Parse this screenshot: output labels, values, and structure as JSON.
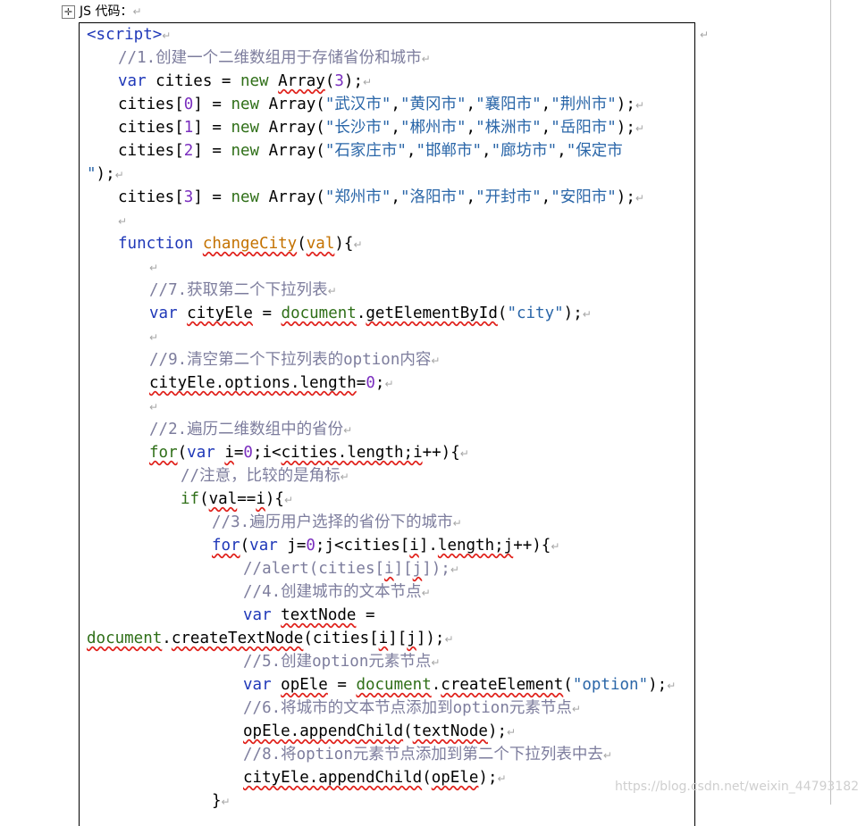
{
  "caption": {
    "label": "JS 代码：",
    "mark": "↵"
  },
  "line_mark": "↵",
  "watermark": "https://blog.csdn.net/weixin_44793182",
  "code_lines": [
    {
      "indent": 0,
      "tokens": [
        {
          "t": "<script>",
          "c": "tag"
        }
      ]
    },
    {
      "indent": 1,
      "tokens": [
        {
          "t": "//1.创建一个二维数组用于存储省份和城市",
          "c": "cm"
        }
      ]
    },
    {
      "indent": 1,
      "tokens": [
        {
          "t": "var",
          "c": "kw"
        },
        {
          "t": " cities = ",
          "c": "plain"
        },
        {
          "t": "new",
          "c": "obj"
        },
        {
          "t": " ",
          "c": "plain"
        },
        {
          "t": "Array",
          "c": "plain",
          "sq": true
        },
        {
          "t": "(",
          "c": "plain"
        },
        {
          "t": "3",
          "c": "num"
        },
        {
          "t": ");",
          "c": "plain"
        }
      ]
    },
    {
      "indent": 1,
      "tokens": [
        {
          "t": "cities[",
          "c": "plain"
        },
        {
          "t": "0",
          "c": "num"
        },
        {
          "t": "] = ",
          "c": "plain"
        },
        {
          "t": "new",
          "c": "obj"
        },
        {
          "t": " Array(",
          "c": "plain"
        },
        {
          "t": "\"武汉市\"",
          "c": "str"
        },
        {
          "t": ",",
          "c": "plain"
        },
        {
          "t": "\"黄冈市\"",
          "c": "str"
        },
        {
          "t": ",",
          "c": "plain"
        },
        {
          "t": "\"襄阳市\"",
          "c": "str"
        },
        {
          "t": ",",
          "c": "plain"
        },
        {
          "t": "\"荆州市\"",
          "c": "str"
        },
        {
          "t": ");",
          "c": "plain"
        }
      ]
    },
    {
      "indent": 1,
      "tokens": [
        {
          "t": "cities[",
          "c": "plain"
        },
        {
          "t": "1",
          "c": "num"
        },
        {
          "t": "] = ",
          "c": "plain"
        },
        {
          "t": "new",
          "c": "obj"
        },
        {
          "t": " Array(",
          "c": "plain"
        },
        {
          "t": "\"长沙市\"",
          "c": "str"
        },
        {
          "t": ",",
          "c": "plain"
        },
        {
          "t": "\"郴州市\"",
          "c": "str"
        },
        {
          "t": ",",
          "c": "plain"
        },
        {
          "t": "\"株洲市\"",
          "c": "str"
        },
        {
          "t": ",",
          "c": "plain"
        },
        {
          "t": "\"岳阳市\"",
          "c": "str"
        },
        {
          "t": ");",
          "c": "plain"
        }
      ]
    },
    {
      "indent": 1,
      "tokens": [
        {
          "t": "cities[",
          "c": "plain"
        },
        {
          "t": "2",
          "c": "num"
        },
        {
          "t": "] = ",
          "c": "plain"
        },
        {
          "t": "new",
          "c": "obj"
        },
        {
          "t": " Array(",
          "c": "plain"
        },
        {
          "t": "\"石家庄市\"",
          "c": "str"
        },
        {
          "t": ",",
          "c": "plain"
        },
        {
          "t": "\"邯郸市\"",
          "c": "str"
        },
        {
          "t": ",",
          "c": "plain"
        },
        {
          "t": "\"廊坊市\"",
          "c": "str"
        },
        {
          "t": ",",
          "c": "plain"
        },
        {
          "t": "\"保定市",
          "c": "str"
        }
      ],
      "nomark": true
    },
    {
      "indent": 0,
      "tokens": [
        {
          "t": "\"",
          "c": "str"
        },
        {
          "t": ");",
          "c": "plain"
        }
      ]
    },
    {
      "indent": 1,
      "tokens": [
        {
          "t": "cities[",
          "c": "plain"
        },
        {
          "t": "3",
          "c": "num"
        },
        {
          "t": "] = ",
          "c": "plain"
        },
        {
          "t": "new",
          "c": "obj"
        },
        {
          "t": " Array(",
          "c": "plain"
        },
        {
          "t": "\"郑州市\"",
          "c": "str"
        },
        {
          "t": ",",
          "c": "plain"
        },
        {
          "t": "\"洛阳市\"",
          "c": "str"
        },
        {
          "t": ",",
          "c": "plain"
        },
        {
          "t": "\"开封市\"",
          "c": "str"
        },
        {
          "t": ",",
          "c": "plain"
        },
        {
          "t": "\"安阳市\"",
          "c": "str"
        },
        {
          "t": ");",
          "c": "plain"
        }
      ]
    },
    {
      "indent": 1,
      "tokens": []
    },
    {
      "indent": 1,
      "tokens": [
        {
          "t": "function",
          "c": "kw"
        },
        {
          "t": " ",
          "c": "plain"
        },
        {
          "t": "changeCity",
          "c": "fn",
          "sq": true
        },
        {
          "t": "(",
          "c": "plain"
        },
        {
          "t": "val",
          "c": "fn",
          "sq": true
        },
        {
          "t": "){",
          "c": "plain"
        }
      ]
    },
    {
      "indent": 2,
      "tokens": []
    },
    {
      "indent": 2,
      "tokens": [
        {
          "t": "//7.获取第二个下拉列表",
          "c": "cm"
        }
      ]
    },
    {
      "indent": 2,
      "tokens": [
        {
          "t": "var",
          "c": "kw"
        },
        {
          "t": " ",
          "c": "plain"
        },
        {
          "t": "cityEle",
          "c": "plain",
          "sq": true
        },
        {
          "t": " = ",
          "c": "plain"
        },
        {
          "t": "document",
          "c": "obj",
          "sq": true
        },
        {
          "t": ".",
          "c": "plain"
        },
        {
          "t": "getElementById",
          "c": "plain",
          "sq": true
        },
        {
          "t": "(",
          "c": "plain"
        },
        {
          "t": "\"city\"",
          "c": "str"
        },
        {
          "t": ");",
          "c": "plain"
        }
      ]
    },
    {
      "indent": 2,
      "tokens": []
    },
    {
      "indent": 2,
      "tokens": [
        {
          "t": "//9.清空第二个下拉列表的option内容",
          "c": "cm"
        }
      ]
    },
    {
      "indent": 2,
      "tokens": [
        {
          "t": "cityEle.options.length",
          "c": "plain",
          "sq": true
        },
        {
          "t": "=",
          "c": "plain"
        },
        {
          "t": "0",
          "c": "num"
        },
        {
          "t": ";",
          "c": "plain"
        }
      ]
    },
    {
      "indent": 2,
      "tokens": []
    },
    {
      "indent": 2,
      "tokens": [
        {
          "t": "//2.遍历二维数组中的省份",
          "c": "cm"
        }
      ]
    },
    {
      "indent": 2,
      "tokens": [
        {
          "t": "for",
          "c": "obj",
          "sq": true
        },
        {
          "t": "(",
          "c": "plain"
        },
        {
          "t": "var",
          "c": "kw"
        },
        {
          "t": " ",
          "c": "plain"
        },
        {
          "t": "i",
          "c": "plain",
          "sq": true
        },
        {
          "t": "=",
          "c": "plain"
        },
        {
          "t": "0",
          "c": "num"
        },
        {
          "t": ";i<",
          "c": "plain"
        },
        {
          "t": "cities.length;i",
          "c": "plain",
          "sq": true
        },
        {
          "t": "++){",
          "c": "plain"
        }
      ]
    },
    {
      "indent": 3,
      "tokens": [
        {
          "t": "//注意，比较的是角标",
          "c": "cm"
        }
      ]
    },
    {
      "indent": 3,
      "tokens": [
        {
          "t": "if",
          "c": "obj"
        },
        {
          "t": "(",
          "c": "plain"
        },
        {
          "t": "val",
          "c": "plain",
          "sq": true
        },
        {
          "t": "==",
          "c": "plain"
        },
        {
          "t": "i",
          "c": "plain",
          "sq": true
        },
        {
          "t": "){",
          "c": "plain"
        }
      ]
    },
    {
      "indent": 4,
      "tokens": [
        {
          "t": "//3.遍历用户选择的省份下的城市",
          "c": "cm"
        }
      ]
    },
    {
      "indent": 4,
      "tokens": [
        {
          "t": "for",
          "c": "kw",
          "sq": true
        },
        {
          "t": "(",
          "c": "plain"
        },
        {
          "t": "var",
          "c": "kw"
        },
        {
          "t": " j=",
          "c": "plain"
        },
        {
          "t": "0",
          "c": "num"
        },
        {
          "t": ";j<cities[",
          "c": "plain"
        },
        {
          "t": "i",
          "c": "plain",
          "sq": true
        },
        {
          "t": "].",
          "c": "plain"
        },
        {
          "t": "length;j",
          "c": "plain",
          "sq": true
        },
        {
          "t": "++){",
          "c": "plain"
        }
      ]
    },
    {
      "indent": 5,
      "tokens": [
        {
          "t": "//alert(cities[",
          "c": "cm"
        },
        {
          "t": "i",
          "c": "cm",
          "sq": true
        },
        {
          "t": "][",
          "c": "cm"
        },
        {
          "t": "j",
          "c": "cm",
          "sq": true
        },
        {
          "t": "]);",
          "c": "cm"
        }
      ]
    },
    {
      "indent": 5,
      "tokens": [
        {
          "t": "//4.创建城市的文本节点",
          "c": "cm"
        }
      ]
    },
    {
      "indent": 5,
      "tokens": [
        {
          "t": "var",
          "c": "kw"
        },
        {
          "t": " ",
          "c": "plain"
        },
        {
          "t": "textNode",
          "c": "plain",
          "sq": true
        },
        {
          "t": " =",
          "c": "plain"
        }
      ],
      "nomark": true
    },
    {
      "indent": 0,
      "tokens": [
        {
          "t": "document",
          "c": "obj",
          "sq": true
        },
        {
          "t": ".",
          "c": "plain"
        },
        {
          "t": "createTextNode",
          "c": "plain",
          "sq": true
        },
        {
          "t": "(cities[",
          "c": "plain"
        },
        {
          "t": "i",
          "c": "plain",
          "sq": true
        },
        {
          "t": "][",
          "c": "plain"
        },
        {
          "t": "j",
          "c": "plain",
          "sq": true
        },
        {
          "t": "]);",
          "c": "plain"
        }
      ]
    },
    {
      "indent": 5,
      "tokens": [
        {
          "t": "//5.创建option元素节点",
          "c": "cm"
        }
      ]
    },
    {
      "indent": 5,
      "tokens": [
        {
          "t": "var",
          "c": "kw"
        },
        {
          "t": " ",
          "c": "plain"
        },
        {
          "t": "opEle",
          "c": "plain",
          "sq": true
        },
        {
          "t": " = ",
          "c": "plain"
        },
        {
          "t": "document",
          "c": "obj",
          "sq": true
        },
        {
          "t": ".",
          "c": "plain"
        },
        {
          "t": "createElement",
          "c": "plain",
          "sq": true
        },
        {
          "t": "(",
          "c": "plain"
        },
        {
          "t": "\"option\"",
          "c": "str"
        },
        {
          "t": ");",
          "c": "plain"
        }
      ]
    },
    {
      "indent": 5,
      "tokens": [
        {
          "t": "//6.将城市的文本节点添加到option元素节点",
          "c": "cm"
        }
      ]
    },
    {
      "indent": 5,
      "tokens": [
        {
          "t": "opEle.appendChild",
          "c": "plain",
          "sq": true
        },
        {
          "t": "(",
          "c": "plain"
        },
        {
          "t": "textNode",
          "c": "plain",
          "sq": true
        },
        {
          "t": ");",
          "c": "plain"
        }
      ]
    },
    {
      "indent": 5,
      "tokens": [
        {
          "t": "//8.将option元素节点添加到第二个下拉列表中去",
          "c": "cm"
        }
      ]
    },
    {
      "indent": 5,
      "tokens": [
        {
          "t": "cityEle.appendChild",
          "c": "plain",
          "sq": true
        },
        {
          "t": "(",
          "c": "plain"
        },
        {
          "t": "opEle",
          "c": "plain",
          "sq": true
        },
        {
          "t": ");",
          "c": "plain"
        }
      ]
    },
    {
      "indent": 4,
      "tokens": [
        {
          "t": "}",
          "c": "plain"
        }
      ]
    }
  ]
}
